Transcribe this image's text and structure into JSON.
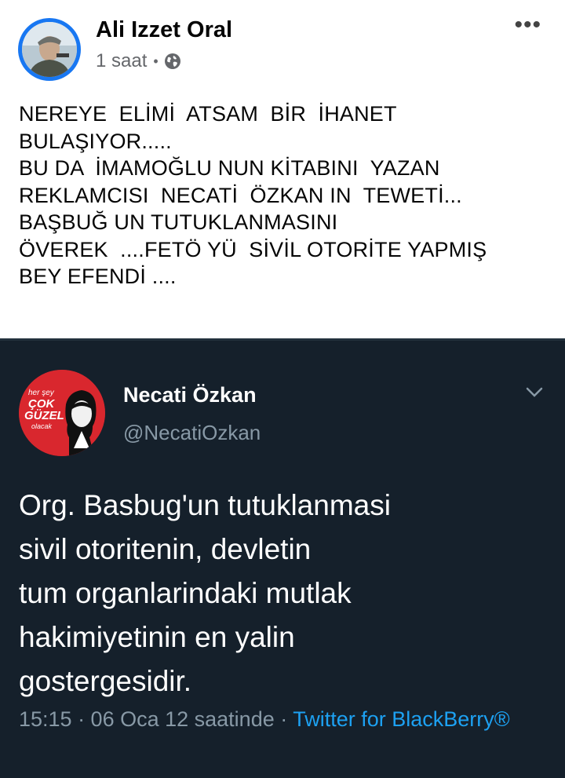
{
  "post": {
    "author": "Ali Izzet Oral",
    "time": "1 saat",
    "separator": "•",
    "privacy_icon": "globe-icon",
    "more_icon": "more-options-icon",
    "more_label": "•••",
    "text": "NEREYE  ELİMİ  ATSAM  BİR  İHANET\nBULAŞIYOR.....\nBU DA  İMAMOĞLU NUN KİTABINI  YAZAN\nREKLAMCISI  NECATİ  ÖZKAN IN  TEWETİ...\nBAŞBUĞ UN TUTUKLANMASINI\nÖVEREK  ....FETÖ YÜ  SİVİL OTORİTE YAPMIŞ\nBEY EFENDİ ...."
  },
  "tweet": {
    "name": "Necati Özkan",
    "handle": "@NecatiOzkan",
    "avatar_text": {
      "line1": "her şey",
      "line2": "ÇOK",
      "line3": "GÜZEL",
      "line4": "olacak"
    },
    "text": "Org. Basbug'un tutuklanmasi\nsivil otoritenin, devletin\ntum organlarindaki mutlak\nhakimiyetinin en yalin\ngostergesidir.",
    "timestamp": "15:15 · 06 Oca 12 saatinde · ",
    "source": "Twitter for BlackBerry®"
  },
  "colors": {
    "fb_blue": "#1877f2",
    "tweet_bg": "#15202b",
    "tweet_muted": "#8899a6",
    "twitter_blue": "#1da1f2",
    "avatar_red": "#d9272e"
  }
}
